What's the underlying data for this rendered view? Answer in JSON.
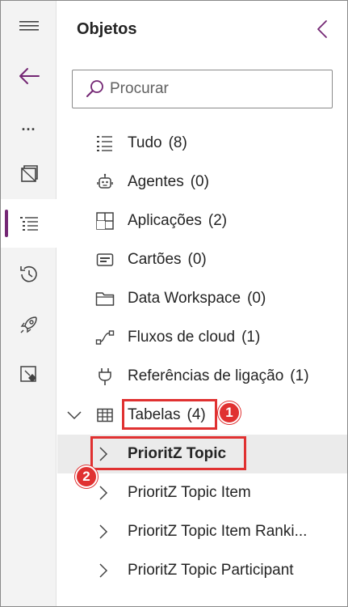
{
  "rail": {
    "items": [
      {
        "name": "menu",
        "icon": "hamburger-icon"
      },
      {
        "name": "back",
        "icon": "back-arrow-icon"
      },
      {
        "name": "more",
        "icon": "more-icon",
        "label": "..."
      },
      {
        "name": "pages",
        "icon": "pages-icon"
      },
      {
        "name": "objects",
        "icon": "tree-list-icon",
        "active": true
      },
      {
        "name": "history",
        "icon": "history-icon"
      },
      {
        "name": "deploy",
        "icon": "rocket-icon"
      },
      {
        "name": "git",
        "icon": "git-icon"
      }
    ],
    "more_label": "...",
    "accent": "#742774"
  },
  "panel": {
    "title": "Objetos",
    "search": {
      "placeholder": "Procurar",
      "value": ""
    }
  },
  "tree": {
    "items": [
      {
        "label": "Tudo",
        "count": "(8)",
        "icon": "list-icon"
      },
      {
        "label": "Agentes",
        "count": "(0)",
        "icon": "bot-icon"
      },
      {
        "label": "Aplicações",
        "count": "(2)",
        "icon": "apps-icon"
      },
      {
        "label": "Cartões",
        "count": "(0)",
        "icon": "card-icon"
      },
      {
        "label": "Data Workspace",
        "count": "(0)",
        "icon": "folder-icon"
      },
      {
        "label": "Fluxos de cloud",
        "count": "(1)",
        "icon": "flow-icon"
      },
      {
        "label": "Referências de ligação",
        "count": "(1)",
        "icon": "plug-icon"
      },
      {
        "label": "Tabelas",
        "count": "(4)",
        "icon": "table-icon",
        "expanded": true
      }
    ],
    "tables": [
      {
        "label": "PrioritZ Topic",
        "selected": true
      },
      {
        "label": "PrioritZ Topic Item"
      },
      {
        "label": "PrioritZ Topic Item Ranki..."
      },
      {
        "label": "PrioritZ Topic Participant"
      }
    ]
  },
  "callouts": [
    {
      "number": "1"
    },
    {
      "number": "2"
    }
  ],
  "colors": {
    "callout": "#e03131",
    "selected_bg": "#ebebeb",
    "accent": "#742774"
  }
}
